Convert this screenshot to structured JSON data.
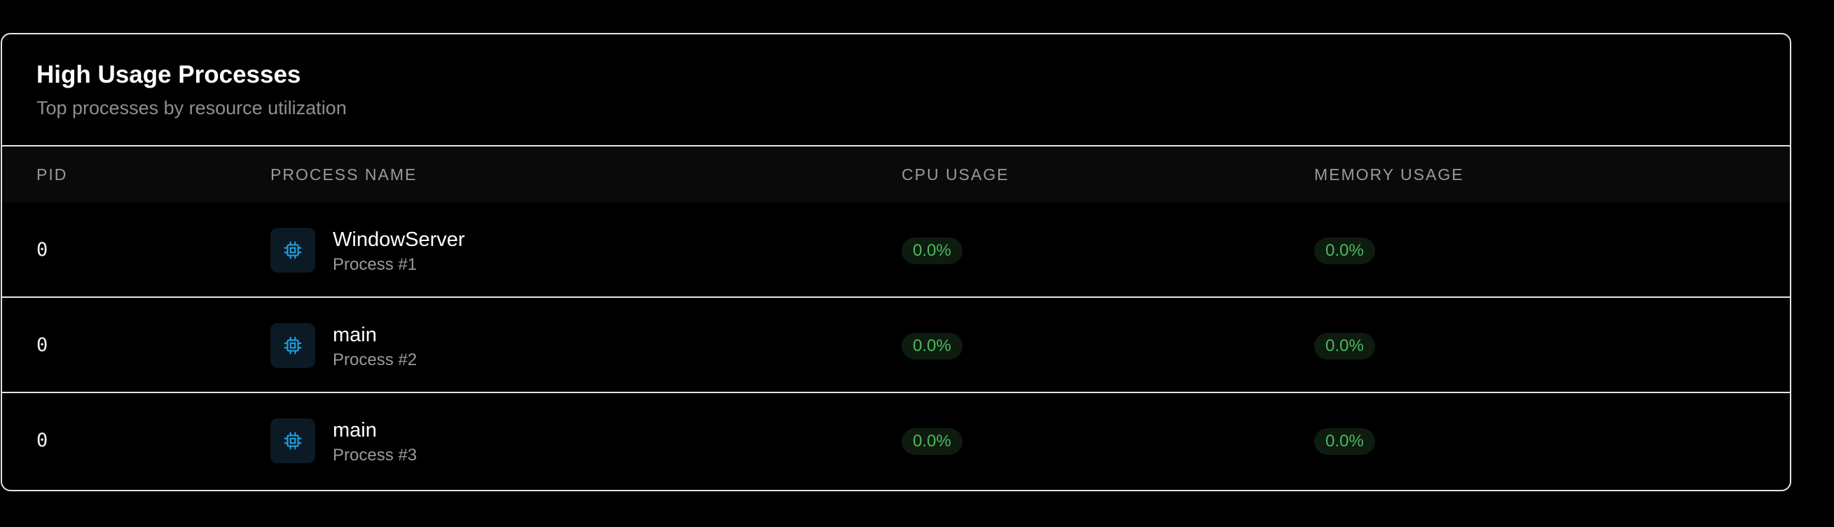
{
  "header": {
    "title": "High Usage Processes",
    "subtitle": "Top processes by resource utilization"
  },
  "columns": {
    "pid": "PID",
    "process_name": "PROCESS NAME",
    "cpu": "CPU USAGE",
    "memory": "MEMORY USAGE"
  },
  "rows": [
    {
      "pid": "0",
      "name": "WindowServer",
      "sub": "Process #1",
      "cpu": "0.0%",
      "memory": "0.0%",
      "icon": "cpu-chip-icon"
    },
    {
      "pid": "0",
      "name": "main",
      "sub": "Process #2",
      "cpu": "0.0%",
      "memory": "0.0%",
      "icon": "cpu-chip-icon"
    },
    {
      "pid": "0",
      "name": "main",
      "sub": "Process #3",
      "cpu": "0.0%",
      "memory": "0.0%",
      "icon": "cpu-chip-icon"
    }
  ],
  "colors": {
    "icon_accent": "#1e9fe0",
    "badge_text": "#4cb85c",
    "badge_bg": "#0e1c10"
  }
}
